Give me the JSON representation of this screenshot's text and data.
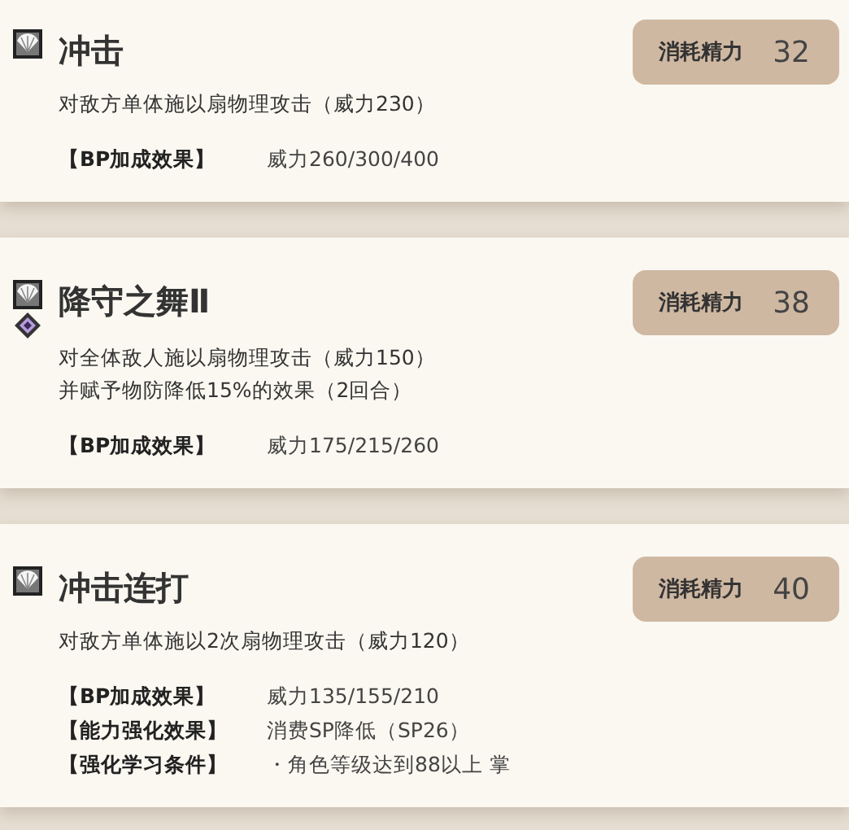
{
  "skills": [
    {
      "name": "冲击",
      "diamond": false,
      "cost_label": "消耗精力",
      "cost": "32",
      "description": [
        "对敌方单体施以扇物理攻击（威力230）"
      ],
      "effects": [
        {
          "label": "【BP加成效果】",
          "value": "威力260/300/400"
        }
      ]
    },
    {
      "name": "降守之舞Ⅱ",
      "diamond": true,
      "cost_label": "消耗精力",
      "cost": "38",
      "description": [
        "对全体敌人施以扇物理攻击（威力150）",
        "并赋予物防降低15%的效果（2回合）"
      ],
      "effects": [
        {
          "label": "【BP加成效果】",
          "value": "威力175/215/260"
        }
      ]
    },
    {
      "name": "冲击连打",
      "diamond": false,
      "cost_label": "消耗精力",
      "cost": "40",
      "description": [
        "对敌方单体施以2次扇物理攻击（威力120）"
      ],
      "effects": [
        {
          "label": "【BP加成效果】",
          "value": "威力135/155/210"
        },
        {
          "label": "【能力强化效果】",
          "value": "消费SP降低（SP26）"
        },
        {
          "label": "【强化学习条件】",
          "value": "・角色等级达到88以上 掌"
        }
      ]
    }
  ]
}
